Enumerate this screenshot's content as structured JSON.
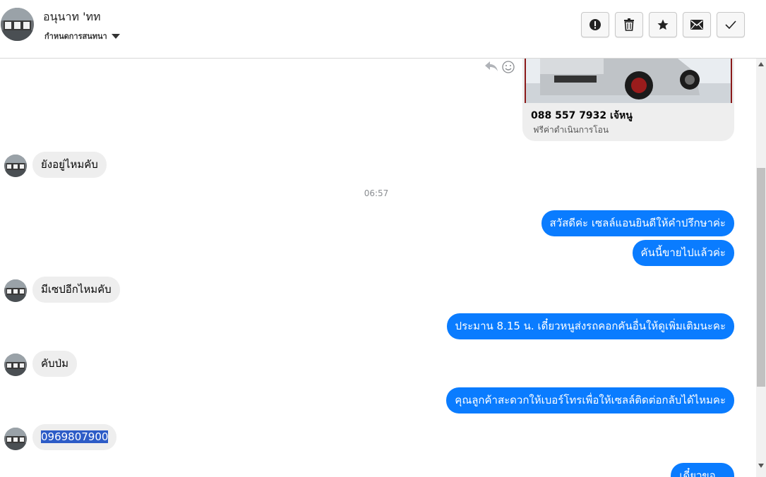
{
  "header": {
    "contact_name": "อนุนาท 'ทท",
    "contact_sub": "กำหนดการสนทนา",
    "actions": [
      "report-icon",
      "trash-icon",
      "star-icon",
      "mail-icon",
      "check-icon"
    ]
  },
  "card": {
    "title": "088 557 7932 เจ้หนู",
    "subtitle": "ฟรีค่าดำเนินการโอน"
  },
  "timestamp": "06:57",
  "messages": [
    {
      "dir": "in",
      "text": "ยังอยู่ไหมคับ"
    },
    {
      "dir": "out",
      "text": "สวัสดีค่ะ เซลล์แอนยินดีให้คำปรึกษาค่ะ"
    },
    {
      "dir": "out",
      "text": "คันนี้ขายไปแล้วค่ะ"
    },
    {
      "dir": "in",
      "text": "มีเซปอีกไหมคับ"
    },
    {
      "dir": "out",
      "text": "ประมาน 8.15 น. เดี๋ยวหนูส่งรถคอกคันอื่นให้ดูเพิ่มเติมนะคะ"
    },
    {
      "dir": "in",
      "text": "คับป่ม"
    },
    {
      "dir": "out",
      "text": "คุณลูกค้าสะดวกให้เบอร์โทรเพื่อให้เซลล์ติดต่อกลับได้ไหมคะ"
    },
    {
      "dir": "in",
      "text": "0969807900"
    },
    {
      "dir": "out",
      "text": "เดี๋ยวขอ..."
    }
  ],
  "colors": {
    "outgoing": "#0a7cff",
    "incoming": "#eeeeee",
    "selection": "#2d5cc7"
  }
}
